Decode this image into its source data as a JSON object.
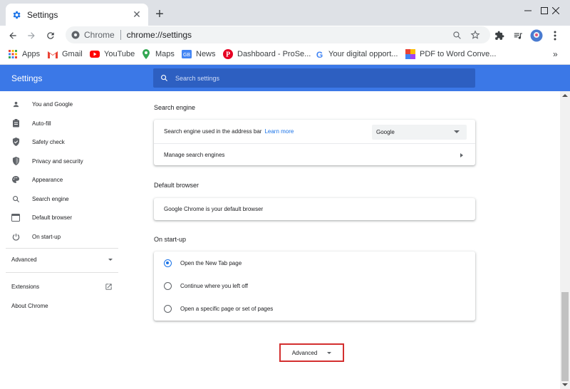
{
  "browser": {
    "tab_title": "Settings",
    "omnibox_site": "Chrome",
    "omnibox_url": "chrome://settings",
    "bookmarks": [
      {
        "label": "Apps",
        "icon": "apps-grid-icon"
      },
      {
        "label": "Gmail",
        "icon": "gmail-icon"
      },
      {
        "label": "YouTube",
        "icon": "youtube-icon"
      },
      {
        "label": "Maps",
        "icon": "maps-icon"
      },
      {
        "label": "News",
        "icon": "news-icon"
      },
      {
        "label": "Dashboard - ProSe...",
        "icon": "pinterest-icon"
      },
      {
        "label": "Your digital opport...",
        "icon": "google-icon"
      },
      {
        "label": "PDF to Word Conve...",
        "icon": "pdf-icon"
      }
    ],
    "bookmarks_overflow": "»"
  },
  "settings": {
    "title": "Settings",
    "search_placeholder": "Search settings",
    "sidebar": [
      {
        "label": "You and Google",
        "icon": "person-icon"
      },
      {
        "label": "Auto-fill",
        "icon": "clipboard-icon"
      },
      {
        "label": "Safety check",
        "icon": "shield-check-icon"
      },
      {
        "label": "Privacy and security",
        "icon": "shield-lock-icon"
      },
      {
        "label": "Appearance",
        "icon": "palette-icon"
      },
      {
        "label": "Search engine",
        "icon": "search-icon"
      },
      {
        "label": "Default browser",
        "icon": "browser-window-icon"
      },
      {
        "label": "On start-up",
        "icon": "power-icon"
      }
    ],
    "sidebar_advanced": "Advanced",
    "sidebar_extensions": "Extensions",
    "sidebar_about": "About Chrome",
    "search_engine": {
      "section_title": "Search engine",
      "address_bar_label": "Search engine used in the address bar",
      "learn_more": "Learn more",
      "selected_engine": "Google",
      "manage_label": "Manage search engines"
    },
    "default_browser": {
      "section_title": "Default browser",
      "status": "Google Chrome is your default browser"
    },
    "startup": {
      "section_title": "On start-up",
      "options": [
        {
          "label": "Open the New Tab page",
          "selected": true
        },
        {
          "label": "Continue where you left off",
          "selected": false
        },
        {
          "label": "Open a specific page or set of pages",
          "selected": false
        }
      ]
    },
    "advanced_button": "Advanced"
  },
  "colors": {
    "header_blue": "#3b78e7",
    "accent_blue": "#1a73e8",
    "highlight_red": "#d32f2f"
  }
}
